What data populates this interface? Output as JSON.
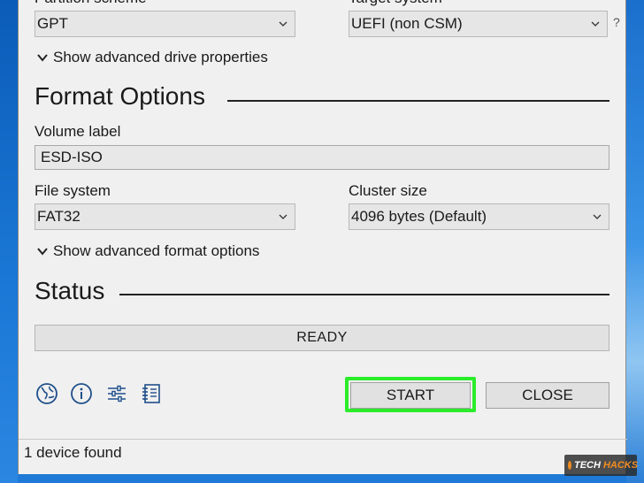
{
  "drive_properties": {
    "partition_scheme_label": "Partition scheme",
    "partition_scheme_value": "GPT",
    "target_system_label": "Target system",
    "target_system_value": "UEFI (non CSM)",
    "target_help": "?",
    "advanced_toggle": "Show advanced drive properties"
  },
  "format_options": {
    "title": "Format Options",
    "volume_label_label": "Volume label",
    "volume_label_value": "ESD-ISO",
    "file_system_label": "File system",
    "file_system_value": "FAT32",
    "cluster_size_label": "Cluster size",
    "cluster_size_value": "4096 bytes (Default)",
    "advanced_toggle": "Show advanced format options"
  },
  "status": {
    "title": "Status",
    "progress_text": "READY"
  },
  "toolbar": {
    "icons": [
      "language-globe-icon",
      "info-icon",
      "settings-sliders-icon",
      "log-icon"
    ],
    "start_label": "START",
    "close_label": "CLOSE"
  },
  "statusbar": {
    "text": "1 device found"
  },
  "watermark": {
    "brand_a": "TECH",
    "brand_b": "HACKS"
  },
  "colors": {
    "desktop_blue": "#1e7ad6",
    "window_bg": "#f0f0f0",
    "highlight_green": "#2bec2b"
  }
}
